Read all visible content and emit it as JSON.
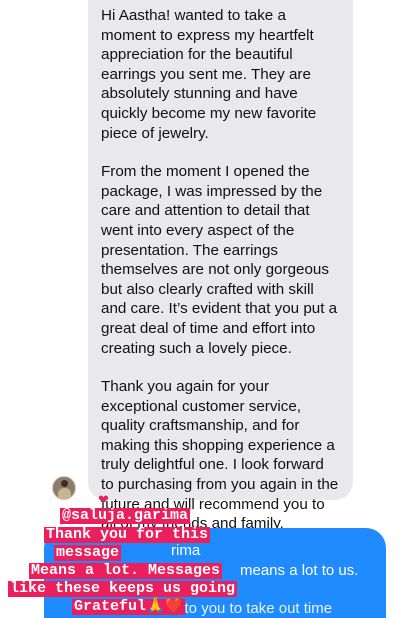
{
  "incoming_message": {
    "paragraphs": [
      "Hi Aastha! wanted to take a moment to express my heartfelt appreciation for the beautiful earrings you sent me. They are absolutely stunning and have quickly become my new favorite piece of jewelry.",
      "From the moment I opened the package, I was impressed by the care and attention to detail that went into every aspect of the presentation. The earrings themselves are not only gorgeous but also clearly crafted with skill and care. It’s evident that you put a great deal of time and effort into creating such a lovely piece.",
      "Thank you again for your exceptional customer service, quality craftsmanship, and for making this shopping experience a truly delightful one. I look forward to purchasing from you again in the future and will recommend you to all of my friends and family."
    ],
    "reaction": "❤"
  },
  "outgoing_message": {
    "line1": "rima",
    "line2": "means a lot to us.",
    "line3": "teful to you to take out time"
  },
  "story_overlay": {
    "mention": "@saluja.garima",
    "line1": "Thank you for this",
    "line2": "message",
    "line3": "Means a lot. Messages",
    "line4": "like these keeps us going",
    "line5": "Grateful",
    "emoji": "🙏❤️"
  },
  "colors": {
    "incoming_bubble": "#e9e9eb",
    "outgoing_bubble": "#1f8bff",
    "sticker_bg": "#ec1f5d"
  },
  "icons": {
    "avatar": "sender-avatar",
    "reaction": "heart-reaction-icon"
  }
}
